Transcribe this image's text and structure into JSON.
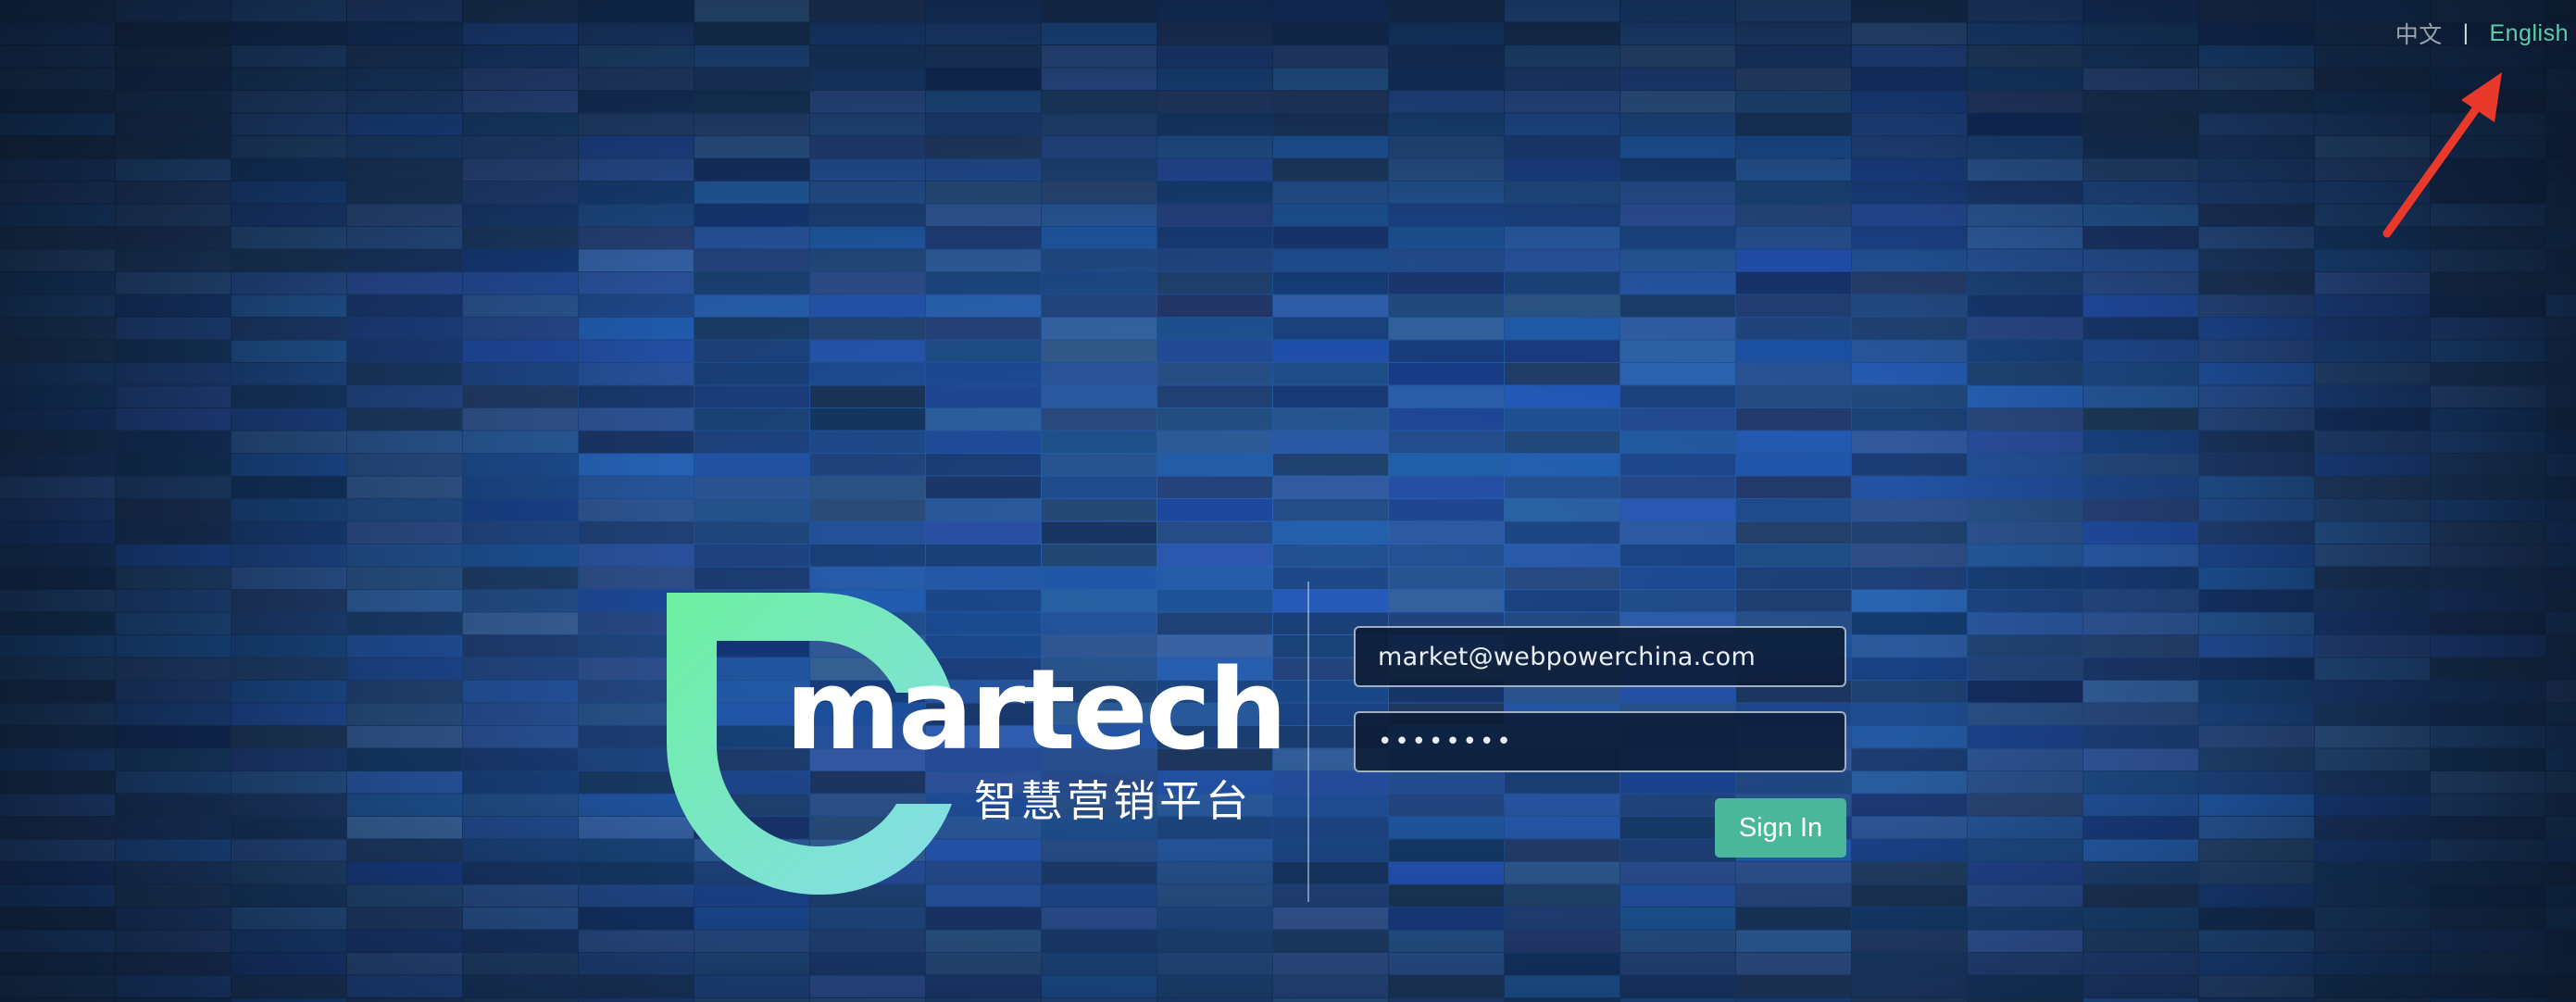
{
  "language_switch": {
    "chinese_label": "中文",
    "separator": "|",
    "english_label": "English"
  },
  "logo": {
    "wordmark": "martech",
    "tagline": "智慧营销平台"
  },
  "login_form": {
    "email_value": "market@webpowerchina.com",
    "password_value": "••••••••",
    "sign_in_label": "Sign In"
  },
  "annotation": {
    "arrow_color": "#e8392b"
  },
  "colors": {
    "accent_green": "#4bb79a",
    "active_language": "#5ccfa8",
    "logo_gradient_start": "#6df0a0",
    "logo_gradient_end": "#86dceb"
  }
}
